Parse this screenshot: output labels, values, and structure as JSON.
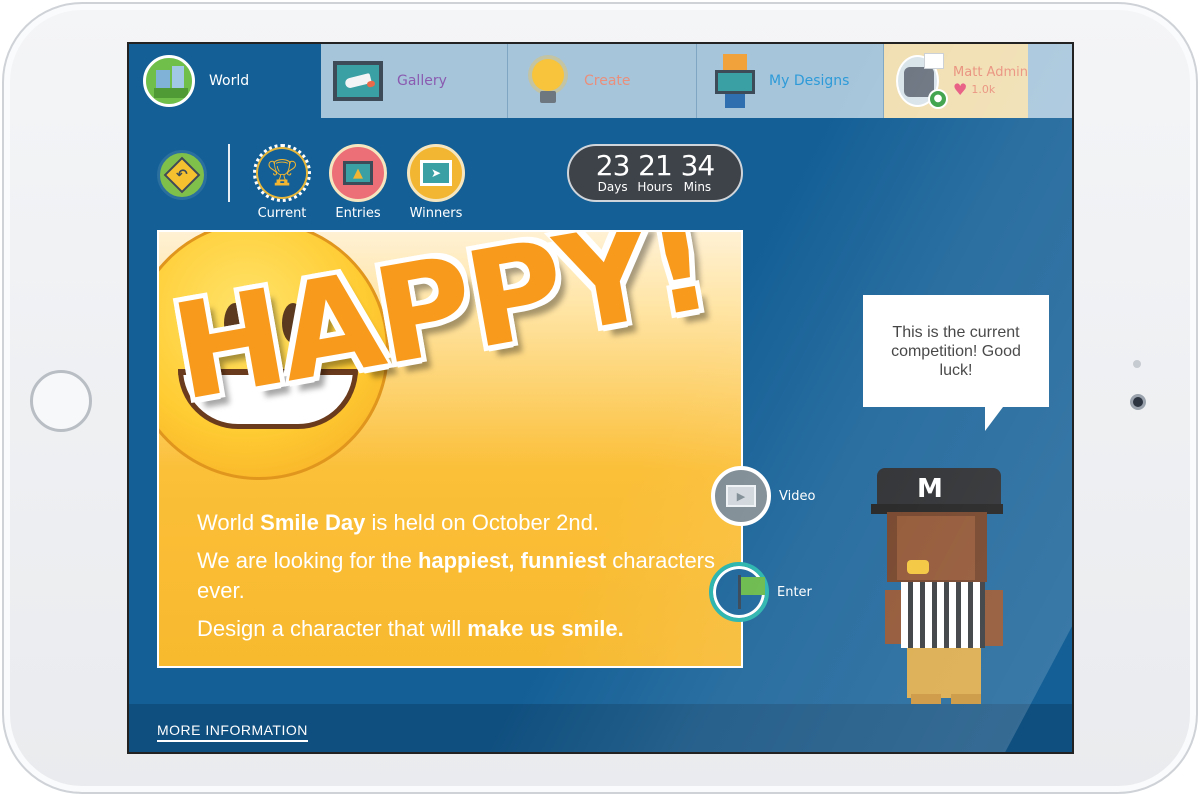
{
  "nav": {
    "tabs": [
      {
        "label": "World",
        "icon": "world-icon"
      },
      {
        "label": "Gallery",
        "icon": "gallery-frame-icon"
      },
      {
        "label": "Create",
        "icon": "lightbulb-icon"
      },
      {
        "label": "My Designs",
        "icon": "robot-icon"
      }
    ],
    "user": {
      "name": "Matt Admin",
      "likes": "1.0k",
      "icon": "heart-icon"
    }
  },
  "toolbar": {
    "back_icon": "back-sign-icon",
    "segments": [
      {
        "label": "Current",
        "icon": "trophy-icon"
      },
      {
        "label": "Entries",
        "icon": "entries-frame-icon"
      },
      {
        "label": "Winners",
        "icon": "winners-frame-icon"
      }
    ]
  },
  "countdown": {
    "days": "23",
    "days_label": "Days",
    "hours": "21",
    "hours_label": "Hours",
    "mins": "34",
    "mins_label": "Mins"
  },
  "competition": {
    "headline": "HAPPY!",
    "line1_a": "World ",
    "line1_b": "Smile Day",
    "line1_c": " is held on October 2nd.",
    "line2_a": "We are looking for the ",
    "line2_b": "happiest, funniest",
    "line2_c": " characters ever.",
    "line3_a": "Design a character that will ",
    "line3_b": "make us smile."
  },
  "actions": {
    "video_label": "Video",
    "enter_label": "Enter"
  },
  "guide": {
    "speech": "This is the current competition! Good luck!",
    "cap_letter": "M"
  },
  "footer": {
    "more_info": "MORE INFORMATION"
  },
  "colors": {
    "screen_bg": "#135f96",
    "tab_inactive": "#a6c5db",
    "user_tab": "#f1dfb2",
    "card": "#f8c03f",
    "headline": "#f89a1c"
  }
}
